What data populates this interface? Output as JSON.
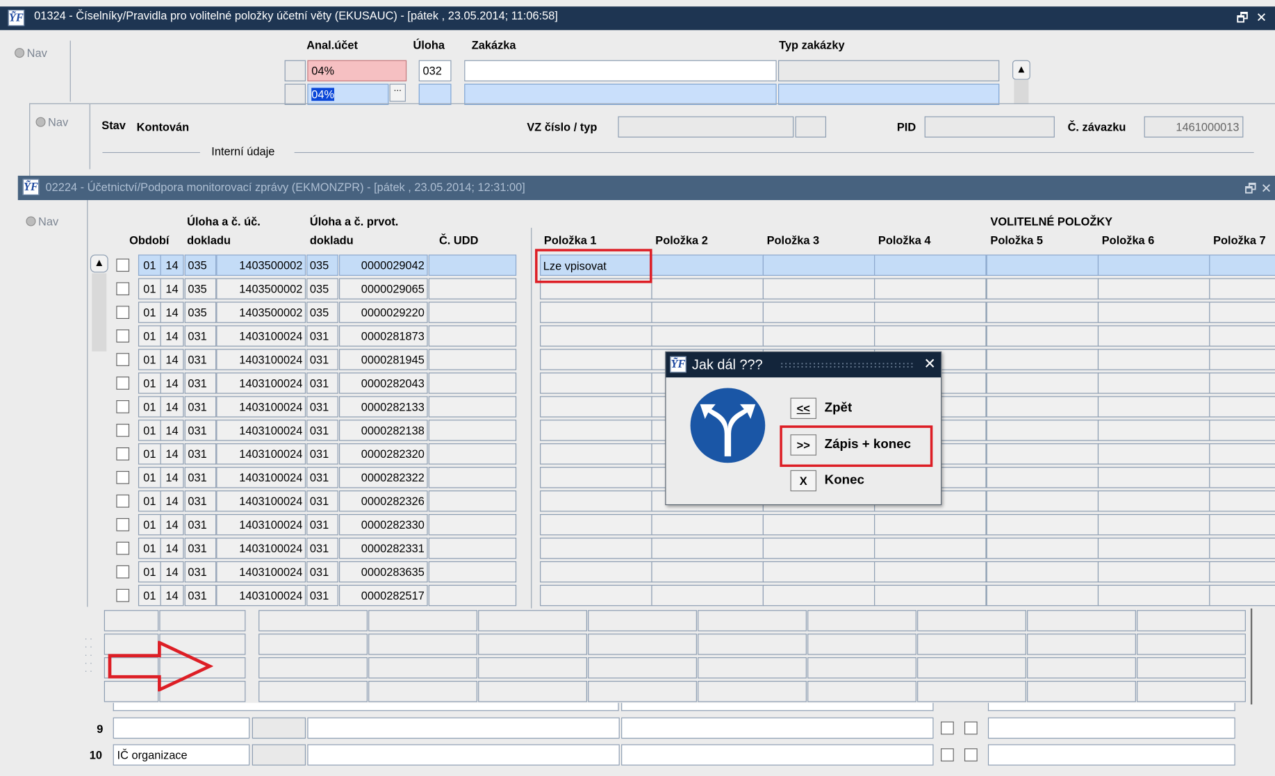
{
  "win1": {
    "title": "01324 - Číselníky/Pravidla pro volitelné položky účetní věty (EKUSAUC) - [pátek  , 23.05.2014; 11:06:58]",
    "nav": "Nav",
    "col_anal": "Anal.účet",
    "col_uloha": "Úloha",
    "col_zakazka": "Zakázka",
    "col_typ": "Typ zakázky",
    "row1_anal": "04%",
    "row1_uloha": "032",
    "row2_anal": "04%",
    "ellipsis": "···",
    "nav2": "Nav",
    "stav_label": "Stav",
    "stav_value": "Kontován",
    "vz_label": "VZ číslo / typ",
    "pid_label": "PID",
    "zavazku_label": "Č. závazku",
    "zavazku_value": "1461000013",
    "interni": "Interní údaje"
  },
  "win2": {
    "title": "02224 - Účetnictví/Podpora monitorovací zprávy (EKMONZPR) - [pátek  , 23.05.2014; 12:31:00]",
    "nav": "Nav",
    "h_obdobi": "Období",
    "h_uloha_uc_1": "Úloha a č. úč.",
    "h_uloha_uc_2": "dokladu",
    "h_uloha_pr_1": "Úloha a č. prvot.",
    "h_uloha_pr_2": "dokladu",
    "h_udd": "Č. UDD",
    "group_title": "VOLITELNÉ POLOŽKY",
    "polozky": [
      "Položka 1",
      "Položka 2",
      "Položka 3",
      "Položka 4",
      "Položka 5",
      "Položka 6",
      "Položka 7"
    ],
    "first_row_p1": "Lze vpisovat",
    "rows": [
      {
        "m": "01",
        "y": "14",
        "u1": "035",
        "doc": "1403500002",
        "u2": "035",
        "prv": "0000029042"
      },
      {
        "m": "01",
        "y": "14",
        "u1": "035",
        "doc": "1403500002",
        "u2": "035",
        "prv": "0000029065"
      },
      {
        "m": "01",
        "y": "14",
        "u1": "035",
        "doc": "1403500002",
        "u2": "035",
        "prv": "0000029220"
      },
      {
        "m": "01",
        "y": "14",
        "u1": "031",
        "doc": "1403100024",
        "u2": "031",
        "prv": "0000281873"
      },
      {
        "m": "01",
        "y": "14",
        "u1": "031",
        "doc": "1403100024",
        "u2": "031",
        "prv": "0000281945"
      },
      {
        "m": "01",
        "y": "14",
        "u1": "031",
        "doc": "1403100024",
        "u2": "031",
        "prv": "0000282043"
      },
      {
        "m": "01",
        "y": "14",
        "u1": "031",
        "doc": "1403100024",
        "u2": "031",
        "prv": "0000282133"
      },
      {
        "m": "01",
        "y": "14",
        "u1": "031",
        "doc": "1403100024",
        "u2": "031",
        "prv": "0000282138"
      },
      {
        "m": "01",
        "y": "14",
        "u1": "031",
        "doc": "1403100024",
        "u2": "031",
        "prv": "0000282320"
      },
      {
        "m": "01",
        "y": "14",
        "u1": "031",
        "doc": "1403100024",
        "u2": "031",
        "prv": "0000282322"
      },
      {
        "m": "01",
        "y": "14",
        "u1": "031",
        "doc": "1403100024",
        "u2": "031",
        "prv": "0000282326"
      },
      {
        "m": "01",
        "y": "14",
        "u1": "031",
        "doc": "1403100024",
        "u2": "031",
        "prv": "0000282330"
      },
      {
        "m": "01",
        "y": "14",
        "u1": "031",
        "doc": "1403100024",
        "u2": "031",
        "prv": "0000282331"
      },
      {
        "m": "01",
        "y": "14",
        "u1": "031",
        "doc": "1403100024",
        "u2": "031",
        "prv": "0000283635"
      },
      {
        "m": "01",
        "y": "14",
        "u1": "031",
        "doc": "1403100024",
        "u2": "031",
        "prv": "0000282517"
      }
    ]
  },
  "bottom": {
    "row9_num": "9",
    "row10_num": "10",
    "row10_value": "IČ organizace"
  },
  "dialog": {
    "title": "Jak dál ???",
    "back_btn": "<<",
    "back_label": "Zpět",
    "save_btn": ">>",
    "save_label": "Zápis + konec",
    "end_btn": "X",
    "end_label": "Konec",
    "close": "✕"
  },
  "colors": {
    "titlebar": "#1e3552",
    "highlight": "#dd1e25",
    "row_selected": "#c4dcf7"
  }
}
